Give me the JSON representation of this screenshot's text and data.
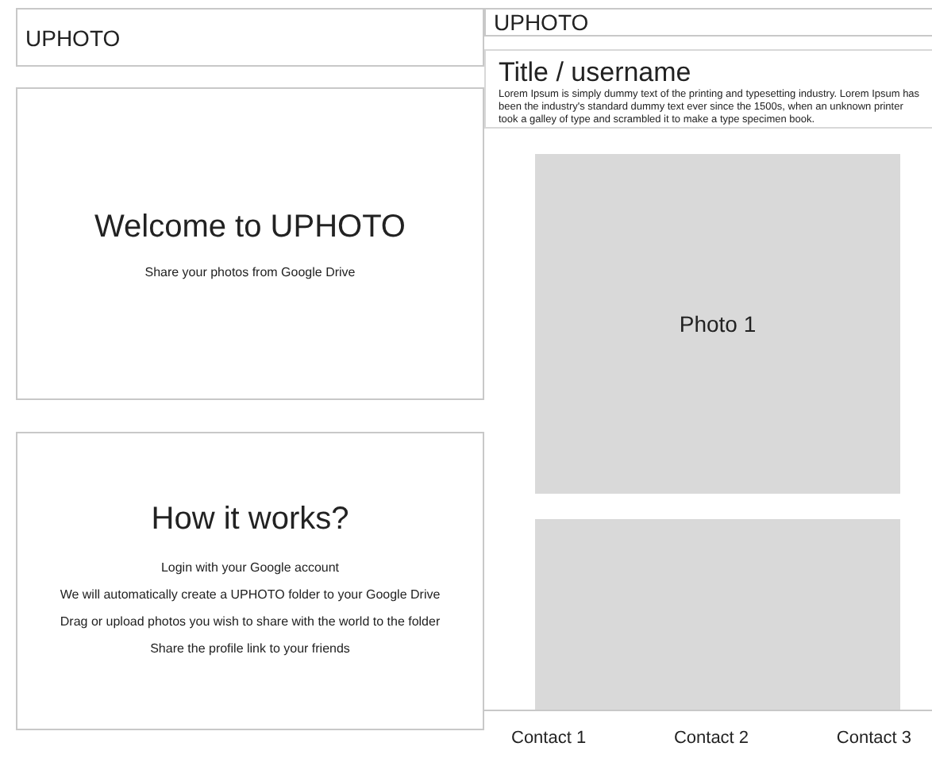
{
  "screens": [
    {
      "header": {
        "brand": "UPHOTO"
      },
      "welcome": {
        "title": "Welcome to UPHOTO",
        "subtitle": "Share your photos from Google Drive"
      },
      "how_it_works": {
        "title": "How it works?",
        "steps": [
          "Login with your Google account",
          "We will automatically create a UPHOTO folder to your Google Drive",
          "Drag or upload photos you wish to share with the world to the folder",
          "Share the profile link to your friends"
        ]
      }
    },
    {
      "header": {
        "brand": "UPHOTO"
      },
      "profile": {
        "title": "Title / username",
        "description": "Lorem Ipsum is simply dummy text of the printing and typesetting industry. Lorem Ipsum has been the industry's standard dummy text ever since the 1500s, when an unknown printer took a galley of type and scrambled it to make a type specimen book."
      },
      "photos": [
        {
          "kind": "captioned",
          "label": "Photo 1"
        },
        {
          "kind": "blank"
        }
      ],
      "footer": {
        "contacts": [
          "Contact 1",
          "Contact 2",
          "Contact 3"
        ]
      }
    }
  ]
}
